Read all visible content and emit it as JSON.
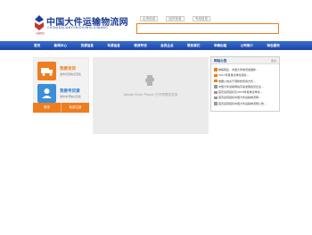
{
  "header": {
    "logo_title": "中国大件运输物流网",
    "logo_pinyin": "CHINADAJIANYUNSHUWULIUWANG",
    "logo_sub": "运输物流"
  },
  "search": {
    "tabs": [
      "出货信息",
      "回货信息",
      "专线信息"
    ]
  },
  "nav": {
    "items": [
      "首页",
      "新闻中心",
      "货源信息",
      "车源信息",
      "物流专线",
      "会员企业",
      "联系我们",
      "车辆出租",
      "公司简介",
      "特色服务"
    ]
  },
  "left_box": {
    "publish_cargo": {
      "title": "我要发货",
      "desc": "发布货源信息至此"
    },
    "find_cargo": {
      "title": "我要寻货源",
      "desc": "发布车源信息至此"
    },
    "buttons": [
      "登录",
      "免费注册"
    ]
  },
  "flash": {
    "text": "Adobe Flash Player 已不再提供支持"
  },
  "news": {
    "title": "网站公告",
    "more": "更多",
    "items": [
      "物联网企、中国大件物流发展新...",
      "2017年度重点单位招标...",
      "重要公告关于调整整费用方式...",
      "中国大件运输网站高速发展会员企业...",
      "首页运营招标及2018年度重点单位...",
      "首页运营招标中国大件运输物流网...",
      "首页运营招标中国大件运输物流网公告..."
    ]
  },
  "colors": {
    "brand_blue": "#1c3f94",
    "nav_blue": "#1945a8",
    "accent_orange": "#ee7d1f"
  }
}
